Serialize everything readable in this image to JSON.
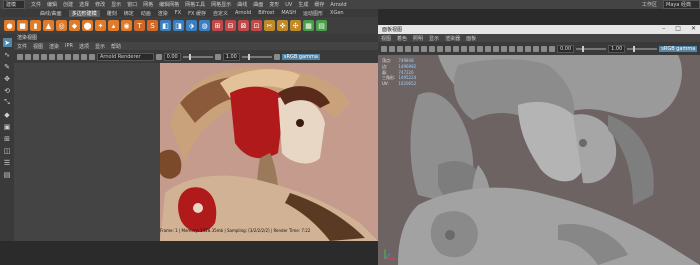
{
  "menu": {
    "mode": "建模",
    "items": [
      "文件",
      "编辑",
      "创建",
      "选择",
      "修改",
      "显示",
      "窗口",
      "网格",
      "编辑网格",
      "网格工具",
      "网格显示",
      "曲线",
      "曲面",
      "变形",
      "UV",
      "生成",
      "缓存",
      "Arnold"
    ],
    "workspace_label": "工作区",
    "workspace_value": "Maya 经典"
  },
  "shelf": {
    "tabs": [
      "曲线/曲面",
      "多边形建模",
      "雕刻",
      "绑定",
      "动画",
      "渲染",
      "FX",
      "FX 缓存",
      "自定义",
      "Arnold",
      "Bifrost",
      "MASH",
      "运动图形",
      "XGen"
    ],
    "active_tab": "多边形建模",
    "icons": [
      {
        "name": "sphere-icon",
        "color": "#e07b2a",
        "glyph": "●"
      },
      {
        "name": "cube-icon",
        "color": "#e07b2a",
        "glyph": "■"
      },
      {
        "name": "cylinder-icon",
        "color": "#e07b2a",
        "glyph": "▮"
      },
      {
        "name": "cone-icon",
        "color": "#e07b2a",
        "glyph": "▲"
      },
      {
        "name": "torus-icon",
        "color": "#e07b2a",
        "glyph": "◎"
      },
      {
        "name": "plane-icon",
        "color": "#e07b2a",
        "glyph": "◆"
      },
      {
        "name": "disk-icon",
        "color": "#e07b2a",
        "glyph": "⬤"
      },
      {
        "name": "platonic-icon",
        "color": "#e07b2a",
        "glyph": "✦"
      },
      {
        "name": "pyramid-icon",
        "color": "#e07b2a",
        "glyph": "▴"
      },
      {
        "name": "pipe-icon",
        "color": "#e07b2a",
        "glyph": "◉"
      },
      {
        "name": "text-tool-icon",
        "color": "#d06a2a",
        "glyph": "T"
      },
      {
        "name": "svg-icon",
        "color": "#d06a2a",
        "glyph": "S"
      },
      {
        "name": "combine-icon",
        "color": "#3a7fc0",
        "glyph": "◧"
      },
      {
        "name": "separate-icon",
        "color": "#3a7fc0",
        "glyph": "◨"
      },
      {
        "name": "extract-icon",
        "color": "#3a7fc0",
        "glyph": "⬗"
      },
      {
        "name": "smooth-icon",
        "color": "#3a7fc0",
        "glyph": "◍"
      },
      {
        "name": "bridge-icon",
        "color": "#c04a4a",
        "glyph": "⊞"
      },
      {
        "name": "extrude-icon",
        "color": "#c04a4a",
        "glyph": "⊟"
      },
      {
        "name": "bevel-icon",
        "color": "#c04a4a",
        "glyph": "⊠"
      },
      {
        "name": "fill-hole-icon",
        "color": "#c04a4a",
        "glyph": "⊡"
      },
      {
        "name": "multi-cut-icon",
        "color": "#c08a2a",
        "glyph": "✂"
      },
      {
        "name": "target-weld-icon",
        "color": "#c08a2a",
        "glyph": "✜"
      },
      {
        "name": "connect-icon",
        "color": "#c08a2a",
        "glyph": "✣"
      },
      {
        "name": "uv-editor-icon",
        "color": "#4aa04a",
        "glyph": "▦"
      },
      {
        "name": "planar-map-icon",
        "color": "#4aa04a",
        "glyph": "▤"
      }
    ]
  },
  "tools": [
    {
      "name": "select-tool-icon",
      "glyph": "➤",
      "active": true
    },
    {
      "name": "lasso-tool-icon",
      "glyph": "∿",
      "active": false
    },
    {
      "name": "paint-select-icon",
      "glyph": "✎",
      "active": false
    },
    {
      "name": "move-tool-icon",
      "glyph": "✥",
      "active": false
    },
    {
      "name": "rotate-tool-icon",
      "glyph": "⟲",
      "active": false
    },
    {
      "name": "scale-tool-icon",
      "glyph": "⤡",
      "active": false
    },
    {
      "name": "last-tool-icon",
      "glyph": "◆",
      "active": false
    },
    {
      "name": "layout-single-icon",
      "glyph": "▣",
      "active": false
    },
    {
      "name": "layout-four-icon",
      "glyph": "⊞",
      "active": false
    },
    {
      "name": "layout-side-icon",
      "glyph": "◫",
      "active": false
    },
    {
      "name": "layout-outliner-icon",
      "glyph": "☰",
      "active": false
    },
    {
      "name": "layout-graph-icon",
      "glyph": "▤",
      "active": false
    }
  ],
  "left_panel": {
    "title": "渲染视图",
    "menu": [
      "文件",
      "视图",
      "渲染",
      "IPR",
      "选项",
      "显示",
      "帮助"
    ],
    "renderer": "Arnold Renderer",
    "exposure": "0.00",
    "gamma_value": "1.00",
    "color_space": "sRGB gamma",
    "status": "Frame: 1  |  Memory: 1428.35mb  |  Sampling: [3/2/2/2/2]  |  Render Time: 7:22"
  },
  "right_window": {
    "title": "面板视图",
    "menu": [
      "视图",
      "着色",
      "照明",
      "显示",
      "渲染器",
      "面板"
    ],
    "exposure": "0.00",
    "gamma_value": "1.00",
    "color_space": "sRGB gamma",
    "hud": [
      {
        "label": "顶点:",
        "value": "749848"
      },
      {
        "label": "边:",
        "value": "1496982"
      },
      {
        "label": "面:",
        "value": "747226"
      },
      {
        "label": "三角形:",
        "value": "1495224"
      },
      {
        "label": "UV:",
        "value": "1020652"
      }
    ]
  }
}
